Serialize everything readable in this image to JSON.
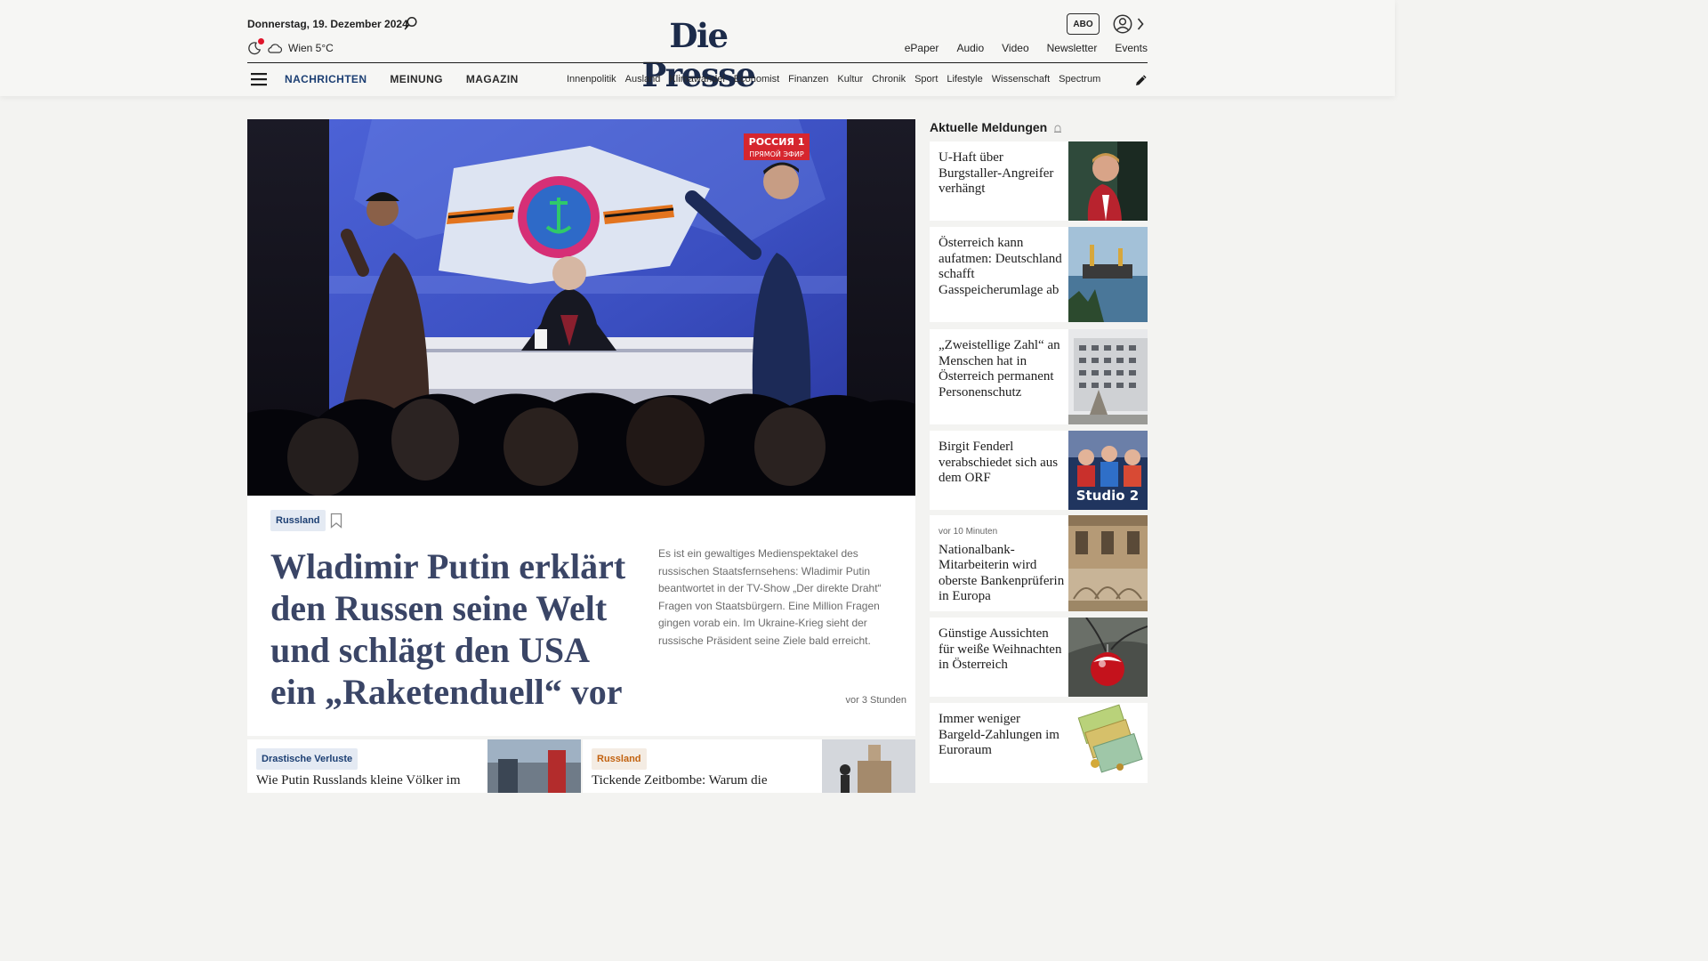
{
  "header": {
    "date": "Donnerstag, 19. Dezember 2024",
    "weather": "Wien 5°C",
    "logo": "Die Presse",
    "abo": "ABO",
    "top_links": [
      "ePaper",
      "Audio",
      "Video",
      "Newsletter",
      "Events"
    ],
    "main_nav": [
      "NACHRICHTEN",
      "MEINUNG",
      "MAGAZIN"
    ],
    "sub_nav": [
      "Innenpolitik",
      "Ausland",
      "Klimawandel",
      "Economist",
      "Finanzen",
      "Kultur",
      "Chronik",
      "Sport",
      "Lifestyle",
      "Wissenschaft",
      "Spectrum"
    ]
  },
  "hero": {
    "tv_logo": "РОССИЯ 1",
    "tv_live": "ПРЯМОЙ ЭФИР",
    "tag": "Russland",
    "title": "Wladimir Putin erklärt den Russen seine Welt und schlägt den USA ein „Raketenduell“ vor",
    "teaser": "Es ist ein gewaltiges Medienspektakel des russischen Staatsfernsehens: Wladimir Putin beantwortet in der TV-Show „Der direkte Draht“ Fragen von Staatsbürgern. Eine Million Fragen gingen vorab ein. Im Ukraine-Krieg sieht der russische Präsident seine Ziele bald erreicht.",
    "time": "vor 3 Stunden"
  },
  "teasers": [
    {
      "tag": "Drastische Verluste",
      "title": "Wie Putin Russlands kleine Völker im"
    },
    {
      "tag": "Russland",
      "title": "Tickende Zeitbombe: Warum die"
    }
  ],
  "sidebar": {
    "title": "Aktuelle Meldungen",
    "items": [
      {
        "time": "",
        "title": "U-Haft über Burgstaller-Angreifer verhängt"
      },
      {
        "time": "",
        "title": "Österreich kann aufatmen: Deutschland schafft Gasspeicherumlage ab"
      },
      {
        "time": "",
        "title": "„Zweistellige Zahl“ an Menschen hat in Österreich permanent Personenschutz"
      },
      {
        "time": "",
        "title": "Birgit Fenderl verabschiedet sich aus dem ORF"
      },
      {
        "time": "vor 10 Minuten",
        "title": "Nationalbank-Mitarbeiterin wird oberste Bankenprüferin in Europa"
      },
      {
        "time": "",
        "title": "Günstige Aussichten für weiße Weihnachten in Österreich"
      },
      {
        "time": "",
        "title": "Immer weniger Bargeld-Zahlungen im Euroraum"
      }
    ],
    "studio_label": "Studio 2"
  },
  "colors": {
    "brand_navy": "#1c2b4a",
    "nav_active": "#1c3f73",
    "hero_title": "#3a4566",
    "accent_red": "#e0152b",
    "tag_orange": "#c2620f"
  },
  "icons": [
    "search-icon",
    "moon-icon",
    "cloud-icon",
    "user-icon",
    "chevron-right-icon",
    "menu-icon",
    "pencil-icon",
    "bookmark-icon",
    "bell-icon"
  ]
}
